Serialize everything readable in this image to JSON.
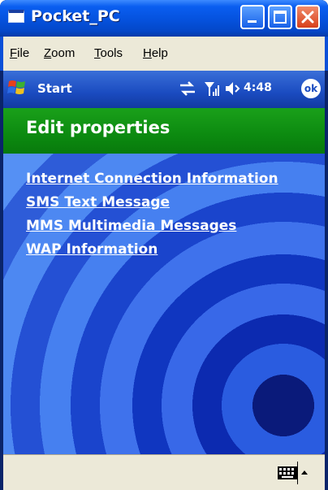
{
  "window": {
    "title": "Pocket_PC"
  },
  "menu": {
    "items": [
      "File",
      "Zoom",
      "Tools",
      "Help"
    ],
    "underline": [
      "F",
      "Z",
      "T",
      "H"
    ],
    "rest": [
      "ile",
      "oom",
      "ools",
      "elp"
    ]
  },
  "taskbar": {
    "start_label": "Start",
    "time": "4:48",
    "ok_label": "ok"
  },
  "header": {
    "title": "Edit properties"
  },
  "links": [
    "Internet Connection Information",
    "SMS Text Message",
    "MMS Multimedia Messages",
    "WAP Information"
  ],
  "icons": [
    "windows-flag-icon",
    "sync-icon",
    "signal-icon",
    "volume-icon",
    "keyboard-icon",
    "up-arrow-icon"
  ]
}
